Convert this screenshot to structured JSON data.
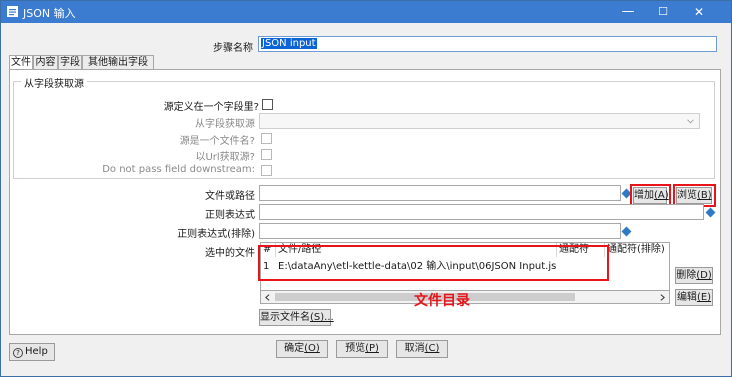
{
  "window": {
    "title": "JSON 输入",
    "minimize": "—",
    "maximize": "☐",
    "close": "✕"
  },
  "step": {
    "label": "步骤名称",
    "value": "JSON input"
  },
  "tabs": [
    "文件",
    "内容",
    "字段",
    "其他输出字段"
  ],
  "group": {
    "title": "从字段获取源",
    "source_in_field_label": "源定义在一个字段里?",
    "get_source_from_field_label": "从字段获取源",
    "source_is_filename_label": "源是一个文件名?",
    "read_as_url_label": "以Url获取源?",
    "pass_downstream_label": "Do not pass field downstream:"
  },
  "file": {
    "path_label": "文件或路径",
    "path_value": "",
    "regex_label": "正则表达式",
    "regex_value": "",
    "regex_exclude_label": "正则表达式(排除)",
    "regex_exclude_value": "",
    "selected_files_label": "选中的文件"
  },
  "buttons": {
    "add_text": "增加",
    "add_key": "(A)",
    "browse_text": "浏览",
    "browse_key": "(B)",
    "delete_text": "删除",
    "delete_key": "(D)",
    "edit_text": "编辑",
    "edit_key": "(E)",
    "show_files_text": "显示文件名",
    "show_files_key": "(S)...",
    "ok_text": "确定",
    "ok_key": "(O)",
    "preview_text": "预览",
    "preview_key": "(P)",
    "cancel_text": "取消",
    "cancel_key": "(C)",
    "help": "Help"
  },
  "table": {
    "headers": [
      "#",
      "文件/路径",
      "通配符",
      "通配符(排除)"
    ],
    "rows": [
      {
        "num": "1",
        "path": "E:\\dataAny\\etl-kettle-data\\02 输入\\input\\06JSON Input.js",
        "wildcard": "",
        "wildcard_exclude": ""
      }
    ]
  },
  "annotation": "文件目录",
  "colors": {
    "titlebar": "#3b7bd0",
    "highlight": "#e8141a",
    "selection": "#0a64d6"
  },
  "icons": {
    "app": "pdi-step-icon",
    "help": "question-circle-icon",
    "variable": "diamond-variable-icon",
    "dropdown": "chevron-down-icon"
  }
}
